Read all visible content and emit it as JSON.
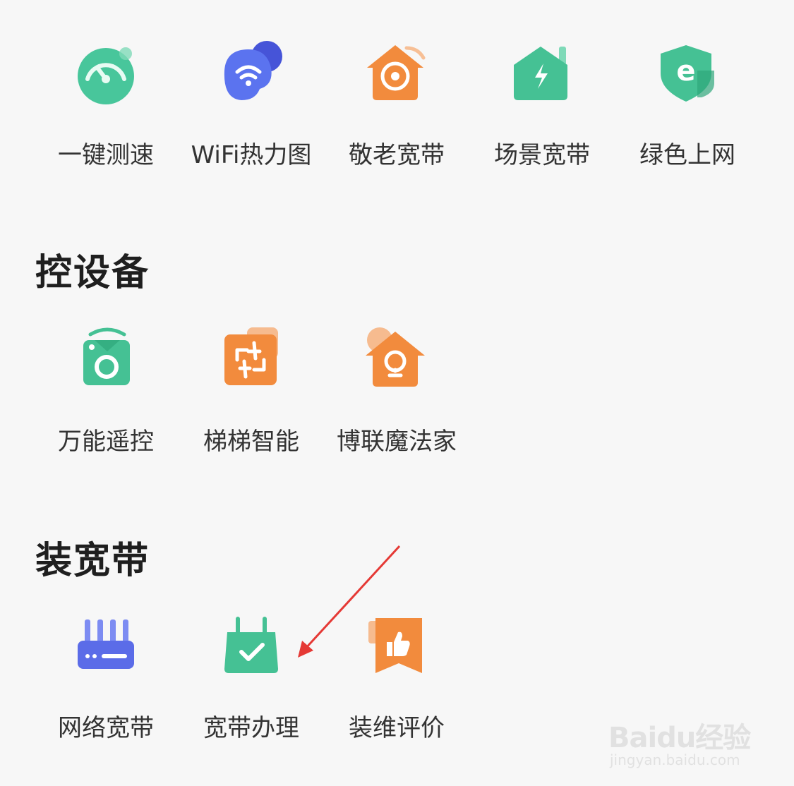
{
  "sections": {
    "tools": {
      "items": [
        {
          "label": "一键测速",
          "icon": "speedometer-icon"
        },
        {
          "label": "WiFi热力图",
          "icon": "wifi-heatmap-icon"
        },
        {
          "label": "敬老宽带",
          "icon": "elder-broadband-icon"
        },
        {
          "label": "场景宽带",
          "icon": "scene-broadband-icon"
        },
        {
          "label": "绿色上网",
          "icon": "green-shield-icon"
        }
      ]
    },
    "control": {
      "title": "控设备",
      "items": [
        {
          "label": "万能遥控",
          "icon": "remote-control-icon"
        },
        {
          "label": "梯梯智能",
          "icon": "elevator-smart-icon"
        },
        {
          "label": "博联魔法家",
          "icon": "smart-home-bulb-icon"
        }
      ]
    },
    "broadband": {
      "title": "装宽带",
      "items": [
        {
          "label": "网络宽带",
          "icon": "router-icon"
        },
        {
          "label": "宽带办理",
          "icon": "broadband-apply-icon"
        },
        {
          "label": "装维评价",
          "icon": "thumbs-up-ribbon-icon"
        }
      ]
    }
  },
  "colors": {
    "green": "#3dbf92",
    "orange": "#f08a3c",
    "blue": "#4f63e8",
    "arrow": "#e53935"
  },
  "watermark": {
    "brand": "Baidu经验",
    "url": "jingyan.baidu.com"
  }
}
